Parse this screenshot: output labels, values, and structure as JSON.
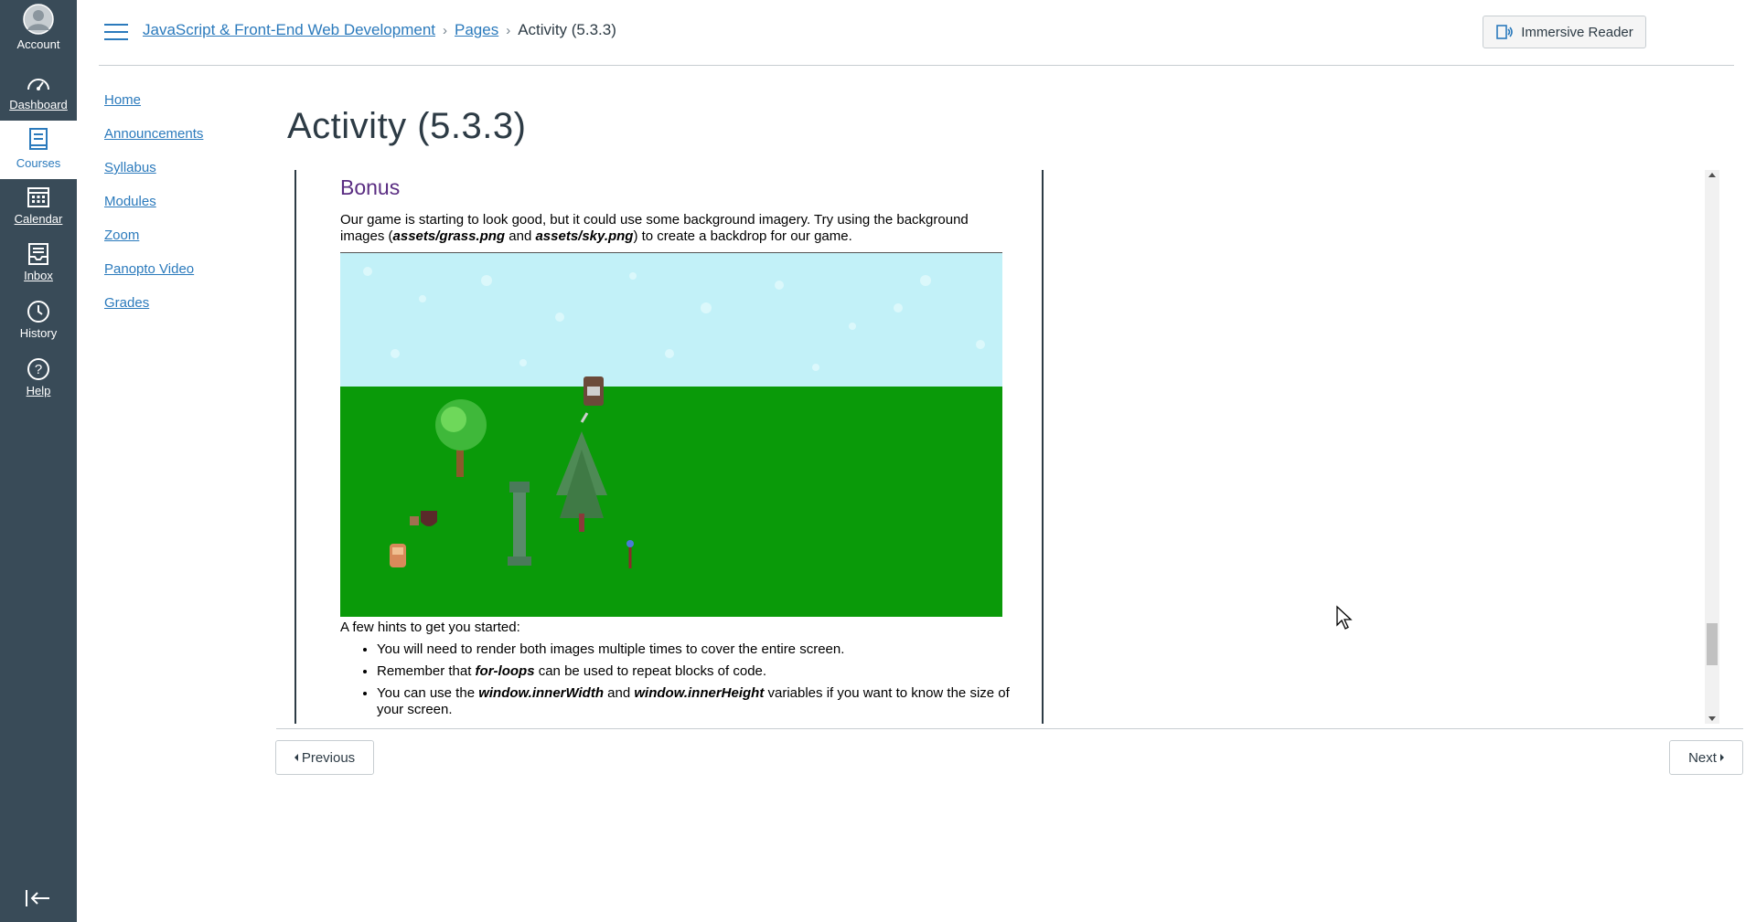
{
  "global_nav": {
    "items": [
      {
        "label": "Account",
        "icon": "account-icon"
      },
      {
        "label": "Dashboard",
        "icon": "dashboard-icon"
      },
      {
        "label": "Courses",
        "icon": "courses-icon"
      },
      {
        "label": "Calendar",
        "icon": "calendar-icon"
      },
      {
        "label": "Inbox",
        "icon": "inbox-icon"
      },
      {
        "label": "History",
        "icon": "history-icon"
      },
      {
        "label": "Help",
        "icon": "help-icon"
      }
    ],
    "collapse_icon": "collapse-nav-icon",
    "bg_color": "#394b58",
    "active_color": "#2b7abc"
  },
  "breadcrumb": {
    "course": "JavaScript & Front-End Web Development",
    "section": "Pages",
    "current": "Activity (5.3.3)"
  },
  "header": {
    "immersive_reader_label": "Immersive Reader"
  },
  "course_nav": [
    "Home",
    "Announcements",
    "Syllabus",
    "Modules",
    "Zoom",
    "Panopto Video",
    "Grades"
  ],
  "page": {
    "title": "Activity (5.3.3)"
  },
  "content": {
    "heading": "Bonus",
    "intro_1": "Our game is starting to look good, but it could use some background imagery. Try using the background images (",
    "asset_grass": "assets/grass.png",
    "intro_and": " and ",
    "asset_sky": "assets/sky.png",
    "intro_2": ") to create a backdrop for our game.",
    "hints_title": "A few hints to get you started:",
    "hint_1": "You will need to render both images multiple times to cover the entire screen.",
    "hint_2_a": "Remember that ",
    "hint_2_b": "for-loops",
    "hint_2_c": " can be used to repeat blocks of code.",
    "hint_3_a": "You can use the ",
    "hint_3_b": "window.innerWidth",
    "hint_3_c": " and ",
    "hint_3_d": "window.innerHeight",
    "hint_3_e": " variables if you want to know the size of your screen."
  },
  "pager": {
    "previous": "Previous",
    "next": "Next"
  },
  "scroll_position": 0.9
}
